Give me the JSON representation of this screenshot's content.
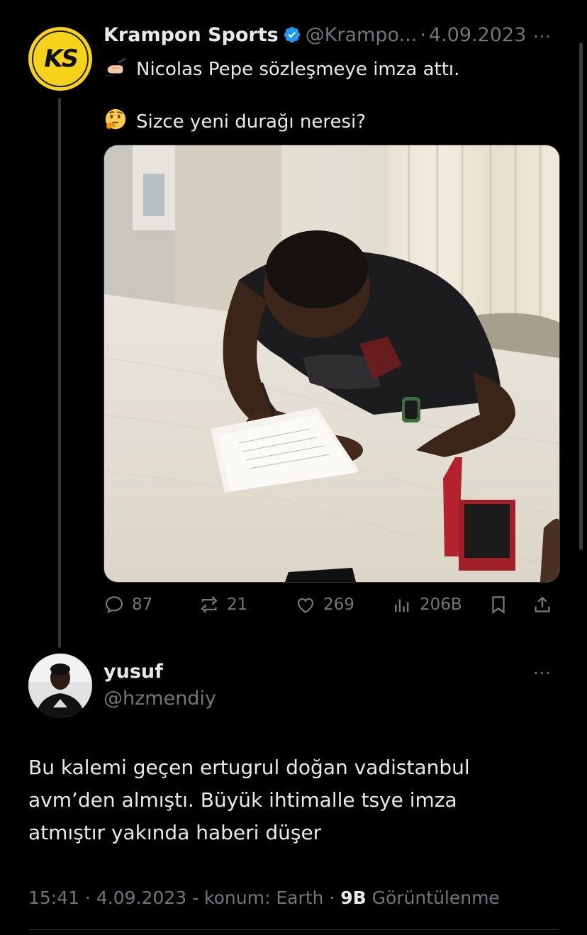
{
  "original_tweet": {
    "display_name": "Krampon Sports",
    "avatar_initials": "KS",
    "handle": "@Krampo...",
    "separator": "·",
    "date": "4.09.2023",
    "more": "···",
    "line1": "Nicolas Pepe sözleşmeye imza attı.",
    "line2": "Sizce yeni durağı neresi?",
    "emoji1": "writing-hand-emoji",
    "emoji2": "thinking-face-emoji",
    "stats": {
      "replies": "87",
      "reposts": "21",
      "likes": "269",
      "views": "206B"
    }
  },
  "reply": {
    "display_name": "yusuf",
    "handle": "@hzmendiy",
    "more": "···",
    "lines": [
      "Bu kalemi geçen ertugrul doğan vadistanbul",
      "avm’den almıştı. Büyük ihtimalle tsye imza",
      "atmıştır yakında haberi düşer"
    ],
    "meta": {
      "time_date": "15:41 · 4.09.2023 - konum: Earth ·",
      "views_count": "9B",
      "views_label": "Görüntülenme"
    }
  },
  "colors": {
    "background": "#000000",
    "text": "#e7e9ea",
    "muted": "#71767b",
    "verified": "#1d9bf0",
    "brand_yellow": "#f6d21b"
  }
}
